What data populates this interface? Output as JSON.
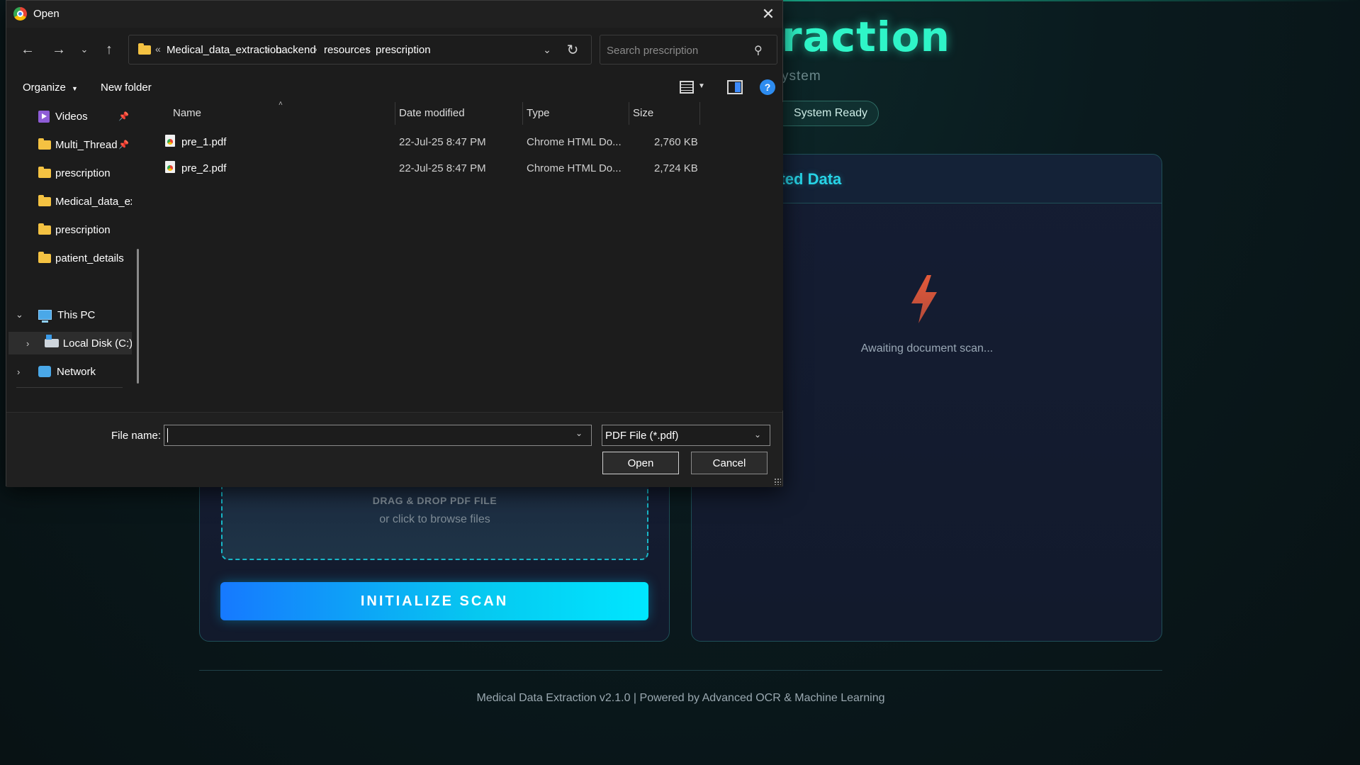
{
  "app": {
    "title": "raction",
    "subtitle": "ystem",
    "status": "System Ready",
    "extracted_header": "acted Data",
    "awaiting": "Awaiting document scan...",
    "drop_title": "DRAG & DROP PDF FILE",
    "drop_sub": "or click to browse files",
    "scan_button": "INITIALIZE SCAN",
    "footer": "Medical Data Extraction v2.1.0 | Powered by Advanced OCR & Machine Learning"
  },
  "dialog": {
    "title": "Open",
    "breadcrumbs": [
      "Medical_data_extraction",
      "backend",
      "resources",
      "prescription"
    ],
    "overflow_marker": "«",
    "search_placeholder": "Search prescription",
    "commands": {
      "organize": "Organize",
      "new_folder": "New folder"
    },
    "nav": {
      "items": [
        {
          "label": "Videos",
          "icon": "videos-icon",
          "pinned": true
        },
        {
          "label": "Multi_Thread",
          "icon": "folder-icon",
          "pinned": true
        },
        {
          "label": "prescription",
          "icon": "folder-icon"
        },
        {
          "label": "Medical_data_ex",
          "icon": "folder-icon"
        },
        {
          "label": "prescription",
          "icon": "folder-icon"
        },
        {
          "label": "patient_details",
          "icon": "folder-icon"
        }
      ],
      "this_pc": "This PC",
      "local_disk": "Local Disk (C:)",
      "network": "Network"
    },
    "columns": {
      "name": "Name",
      "date": "Date modified",
      "type": "Type",
      "size": "Size"
    },
    "files": [
      {
        "name": "pre_1.pdf",
        "date": "22-Jul-25 8:47 PM",
        "type": "Chrome HTML Do...",
        "size": "2,760 KB"
      },
      {
        "name": "pre_2.pdf",
        "date": "22-Jul-25 8:47 PM",
        "type": "Chrome HTML Do...",
        "size": "2,724 KB"
      }
    ],
    "file_name_label": "File name:",
    "file_name_value": "",
    "file_type": "PDF File (*.pdf)",
    "open_button": "Open",
    "cancel_button": "Cancel"
  },
  "colors": {
    "accent": "#2ff5c8",
    "scan_gradient_start": "#1679ff",
    "scan_gradient_end": "#00e6ff",
    "dialog_bg": "#1c1c1c"
  }
}
